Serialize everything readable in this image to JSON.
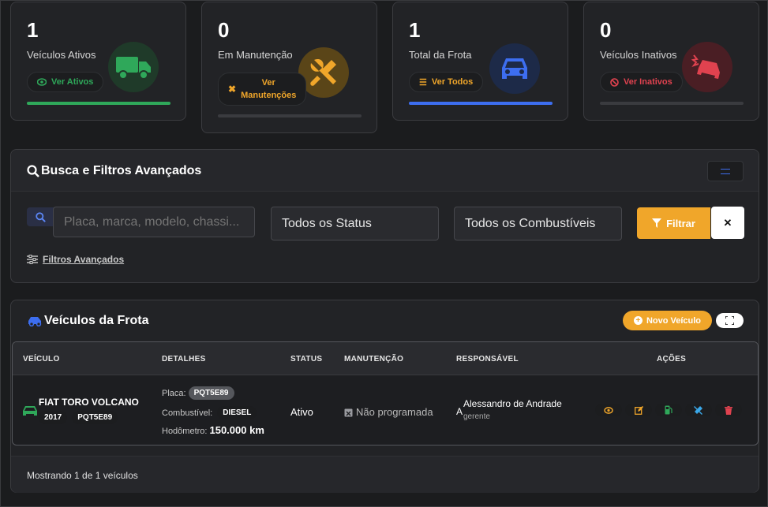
{
  "stats": [
    {
      "value": "1",
      "label": "Veículos Ativos",
      "action": "Ver Ativos",
      "action_icon": "eye-icon",
      "icon": "truck-icon",
      "color": "#2fa85a"
    },
    {
      "value": "0",
      "label": "Em Manutenção",
      "action_line1": "Ver",
      "action_line2": "Manutenções",
      "action_icon": "tools-icon",
      "icon": "wrench-screwdriver-icon",
      "color": "#f0a62a"
    },
    {
      "value": "1",
      "label": "Total da Frota",
      "action": "Ver Todos",
      "action_icon": "list-icon",
      "icon": "car-front-icon",
      "color": "#3d6ef0"
    },
    {
      "value": "0",
      "label": "Veículos Inativos",
      "action": "Ver Inativos",
      "action_icon": "ban-icon",
      "icon": "car-crash-icon",
      "color": "#e0424f"
    }
  ],
  "filters": {
    "title": "Busca e Filtros Avançados",
    "search_placeholder": "Placa, marca, modelo, chassi...",
    "status_select": "Todos os Status",
    "fuel_select": "Todos os Combustíveis",
    "filter_button": "Filtrar",
    "clear_button": "✕",
    "advanced_link": "Filtros Avançados"
  },
  "fleet": {
    "title": "Veículos da Frota",
    "new_button": "Novo Veículo",
    "columns": [
      "VEÍCULO",
      "DETALHES",
      "STATUS",
      "MANUTENÇÃO",
      "RESPONSÁVEL",
      "AÇÕES"
    ],
    "rows": [
      {
        "name": "FIAT TORO VOLCANO",
        "year": "2017",
        "plate": "PQT5E89",
        "plate_label": "Placa:",
        "plate_value": "PQT5E89",
        "fuel_label": "Combustível:",
        "fuel_value": "DIESEL",
        "odometer_label": "Hodômetro:",
        "odometer_value": "150.000 km",
        "status": "Ativo",
        "maintenance": "Não programada",
        "responsible_initial": "A",
        "responsible_name": "Alessandro de Andrade",
        "responsible_role": "gerente"
      }
    ],
    "footer": "Mostrando 1 de 1 veículos"
  }
}
